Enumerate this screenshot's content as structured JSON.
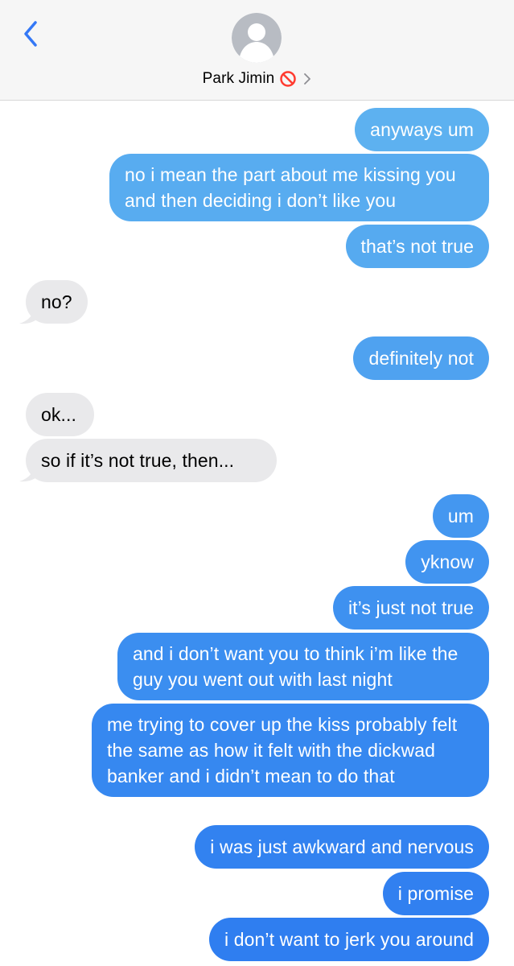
{
  "header": {
    "contact_name": "Park Jimin",
    "back_icon": "chevron-left-icon",
    "blocked_icon": "blocked-icon",
    "details_icon": "chevron-right-icon"
  },
  "colors": {
    "outgoing_top": "#5fb0f0",
    "outgoing_bottom": "#2f7ef0",
    "incoming": "#e9e9eb",
    "accent": "#3478f6",
    "blocked": "#ff3b30"
  },
  "messages": [
    {
      "side": "out",
      "text": "anyways um"
    },
    {
      "side": "out",
      "text": "no i mean the part about me kissing you and then deciding i don’t like you"
    },
    {
      "side": "out",
      "text": "that’s not true"
    },
    {
      "side": "in",
      "text": "no?"
    },
    {
      "side": "out",
      "text": "definitely not"
    },
    {
      "side": "in",
      "text": "ok..."
    },
    {
      "side": "in",
      "text": "so if it’s not true, then..."
    },
    {
      "side": "out",
      "text": "um"
    },
    {
      "side": "out",
      "text": "yknow"
    },
    {
      "side": "out",
      "text": "it’s just not true"
    },
    {
      "side": "out",
      "text": "and i don’t want you to think i’m like the guy you went out with last night"
    },
    {
      "side": "out",
      "text": "me trying to cover up the kiss probably felt the same as how it felt with the dickwad banker and i didn’t mean to do that"
    },
    {
      "side": "out",
      "text": "i was just awkward and nervous"
    },
    {
      "side": "out",
      "text": "i promise"
    },
    {
      "side": "out",
      "text": "i don’t want to jerk you around"
    }
  ]
}
